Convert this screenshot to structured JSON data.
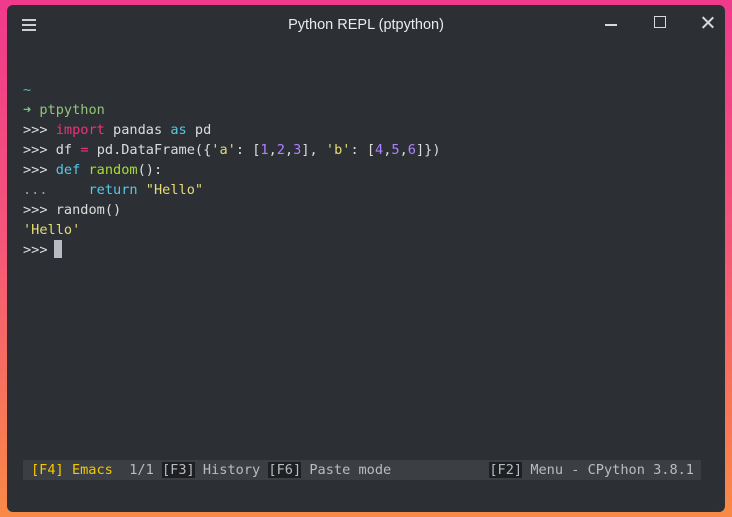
{
  "window": {
    "title": "Python REPL (ptpython)",
    "icons": {
      "menu": "hamburger-menu-icon",
      "minimize": "minimize-icon",
      "maximize": "maximize-icon",
      "close": "close-icon"
    }
  },
  "terminal": {
    "cwd": "~",
    "arrow": "➜",
    "command": "ptpython",
    "prompt": ">>>",
    "continuation": "...",
    "line1": {
      "kw_import": "import",
      "module": "pandas",
      "kw_as": "as",
      "alias": "pd"
    },
    "line2": {
      "var": "df",
      "eq": "=",
      "obj": "pd",
      "attr": ".DataFrame({",
      "key_a": "'a'",
      "colon1": ":",
      "open1": "[",
      "n1": "1",
      "n2": "2",
      "n3": "3",
      "close1": "],",
      "key_b": "'b'",
      "colon2": ":",
      "open2": "[",
      "n4": "4",
      "n5": "5",
      "n6": "6",
      "close2": "]})",
      "comma": ","
    },
    "line3": {
      "kw_def": "def",
      "fname": "random",
      "paren": "():"
    },
    "line4": {
      "kw_return": "return",
      "value": "\"Hello\""
    },
    "line5": {
      "call": "random()"
    },
    "output": "'Hello'"
  },
  "statusbar": {
    "f4_key": "[F4]",
    "mode": "Emacs",
    "position": "1/1",
    "f3_key": "[F3]",
    "f3_label": "History",
    "f6_key": "[F6]",
    "f6_label": "Paste mode",
    "f2_key": "[F2]",
    "f2_label": "Menu - CPython 3.8.1"
  }
}
